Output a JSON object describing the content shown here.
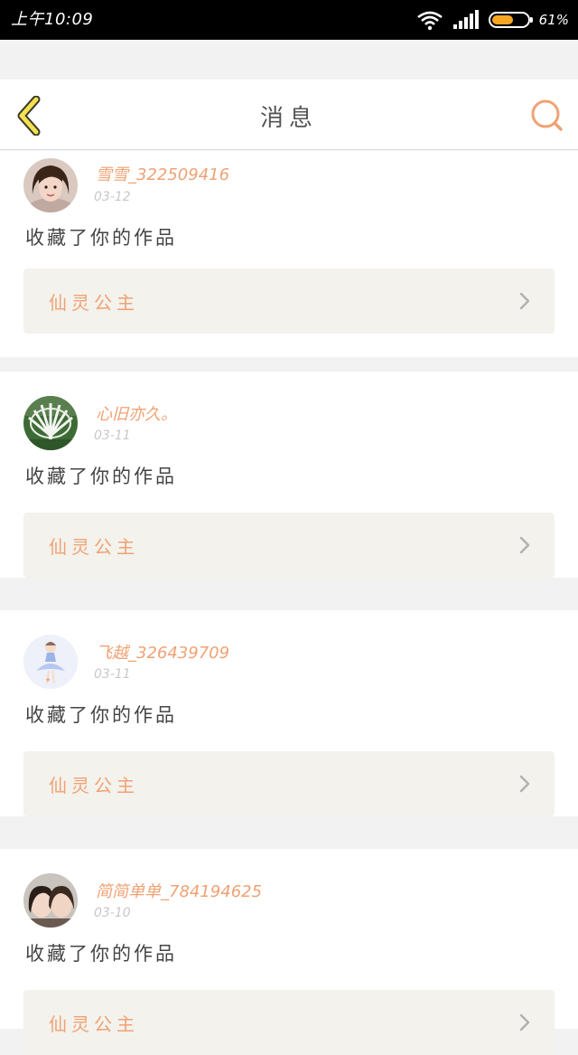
{
  "status_bar": {
    "time": "上午10:09",
    "battery_percent_text": "61%",
    "battery_level": 0.61,
    "icons": [
      "wifi-icon",
      "signal-icon",
      "battery-icon"
    ]
  },
  "header": {
    "title": "消息",
    "back_icon": "chevron-left-icon",
    "search_icon": "search-icon",
    "accent_color": "#f0a274",
    "back_color": "#f5e050"
  },
  "messages": [
    {
      "username": "雪雪_322509416",
      "date": "03-12",
      "action": "收藏了你的作品",
      "work_title": "仙灵公主"
    },
    {
      "username": "心旧亦久。",
      "date": "03-11",
      "action": "收藏了你的作品",
      "work_title": "仙灵公主"
    },
    {
      "username": "飞越_326439709",
      "date": "03-11",
      "action": "收藏了你的作品",
      "work_title": "仙灵公主"
    },
    {
      "username": "简简单单_784194625",
      "date": "03-10",
      "action": "收藏了你的作品",
      "work_title": "仙灵公主"
    }
  ]
}
